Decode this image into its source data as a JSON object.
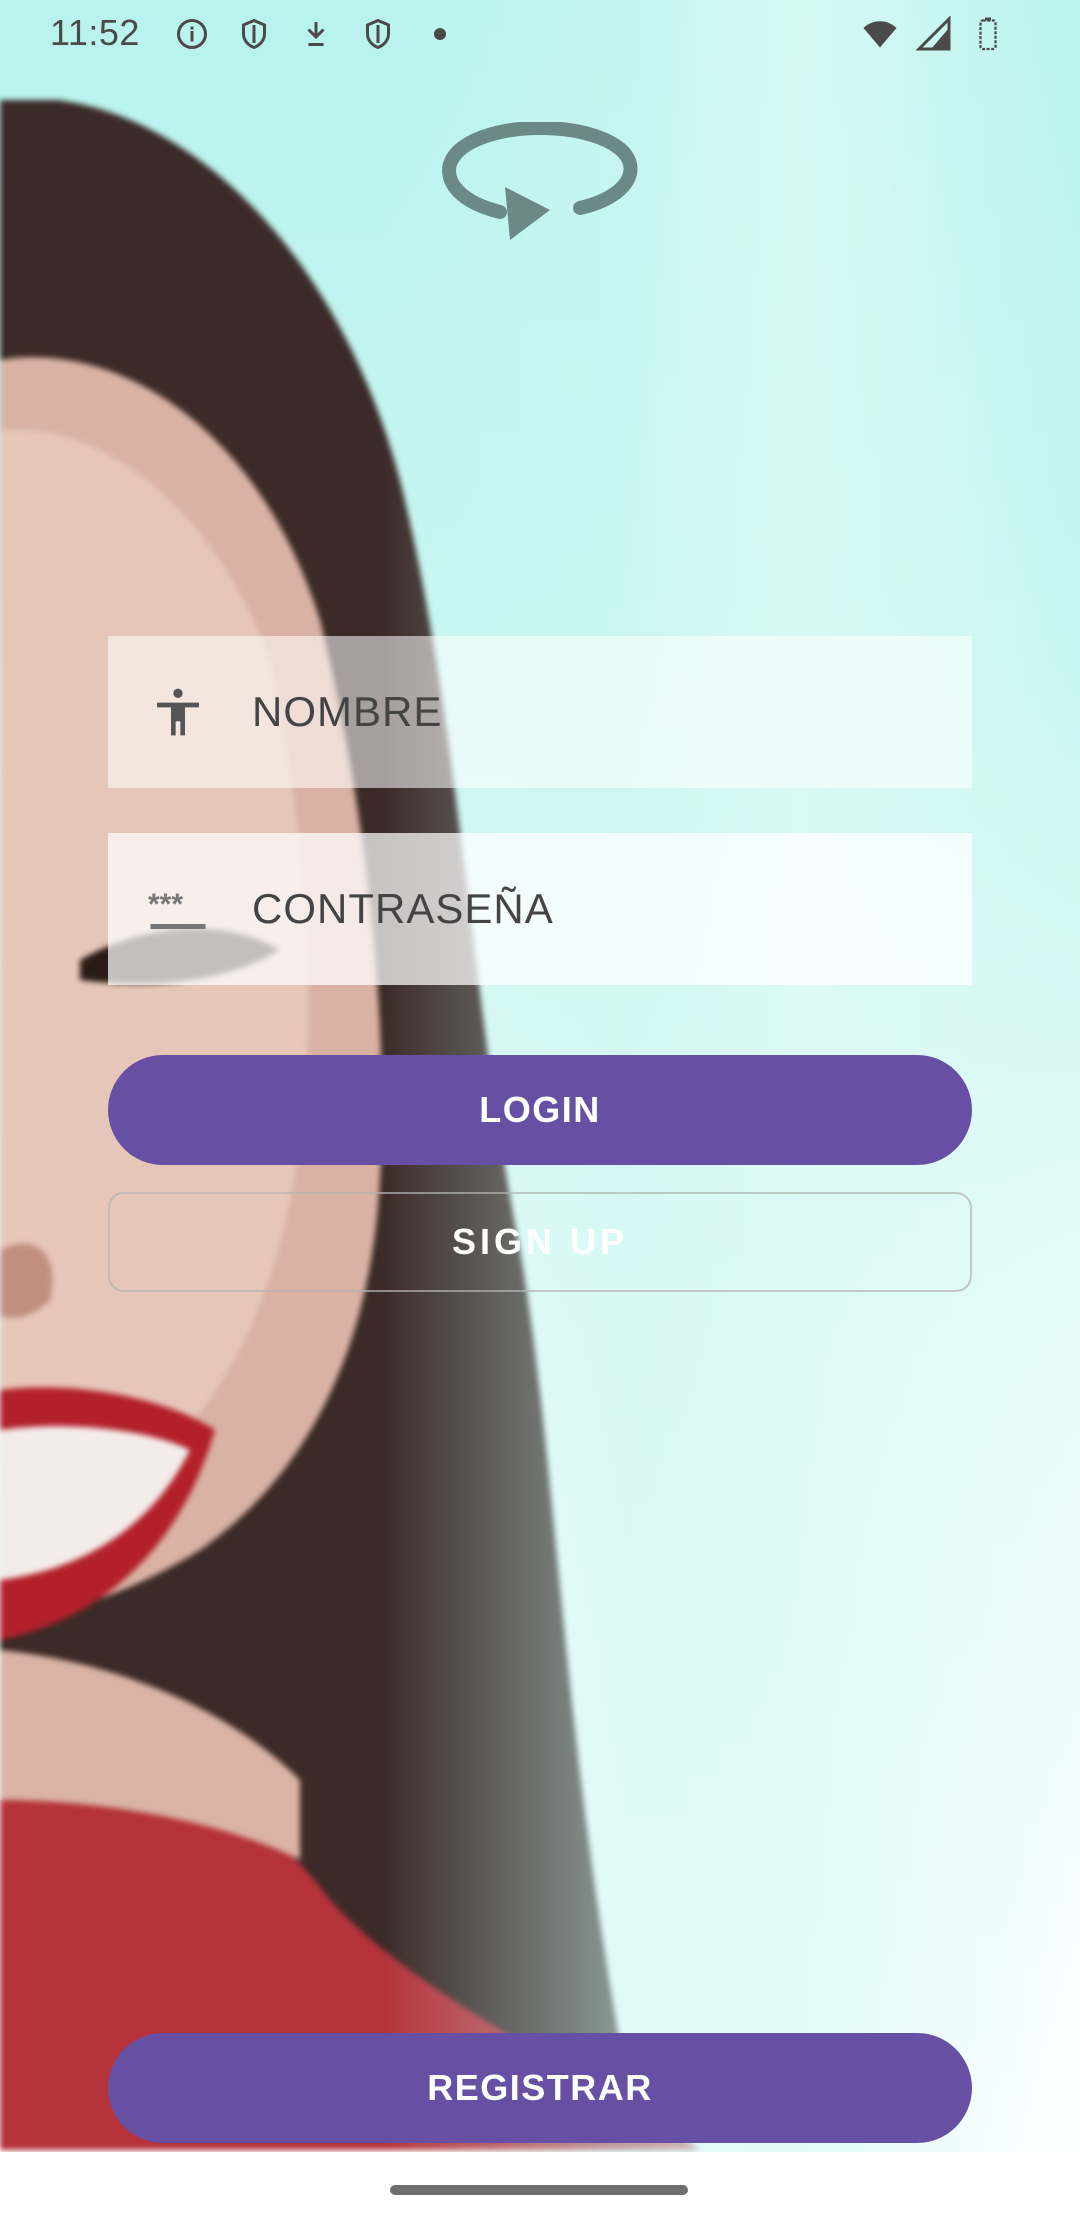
{
  "status_bar": {
    "time": "11:52",
    "left_icons": [
      "info-icon",
      "shield-icon",
      "download-icon",
      "shield-icon",
      "dot-icon"
    ],
    "right_icons": [
      "wifi-icon",
      "signal-icon",
      "battery-icon"
    ]
  },
  "logo": {
    "icon": "rotate-arrow-logo",
    "color": "#6b8a87"
  },
  "form": {
    "username": {
      "icon": "accessibility-person-icon",
      "placeholder": "NOMBRE"
    },
    "password": {
      "icon": "password-dots-icon",
      "placeholder": "CONTRASEÑA"
    },
    "login_label": "LOGIN",
    "signup_label": "SIGN UP"
  },
  "footer": {
    "registrar_label": "REGISTRAR"
  },
  "colors": {
    "primary": "#6750a4",
    "background_top": "#b9f3ee",
    "background_bottom": "#ffffff"
  }
}
